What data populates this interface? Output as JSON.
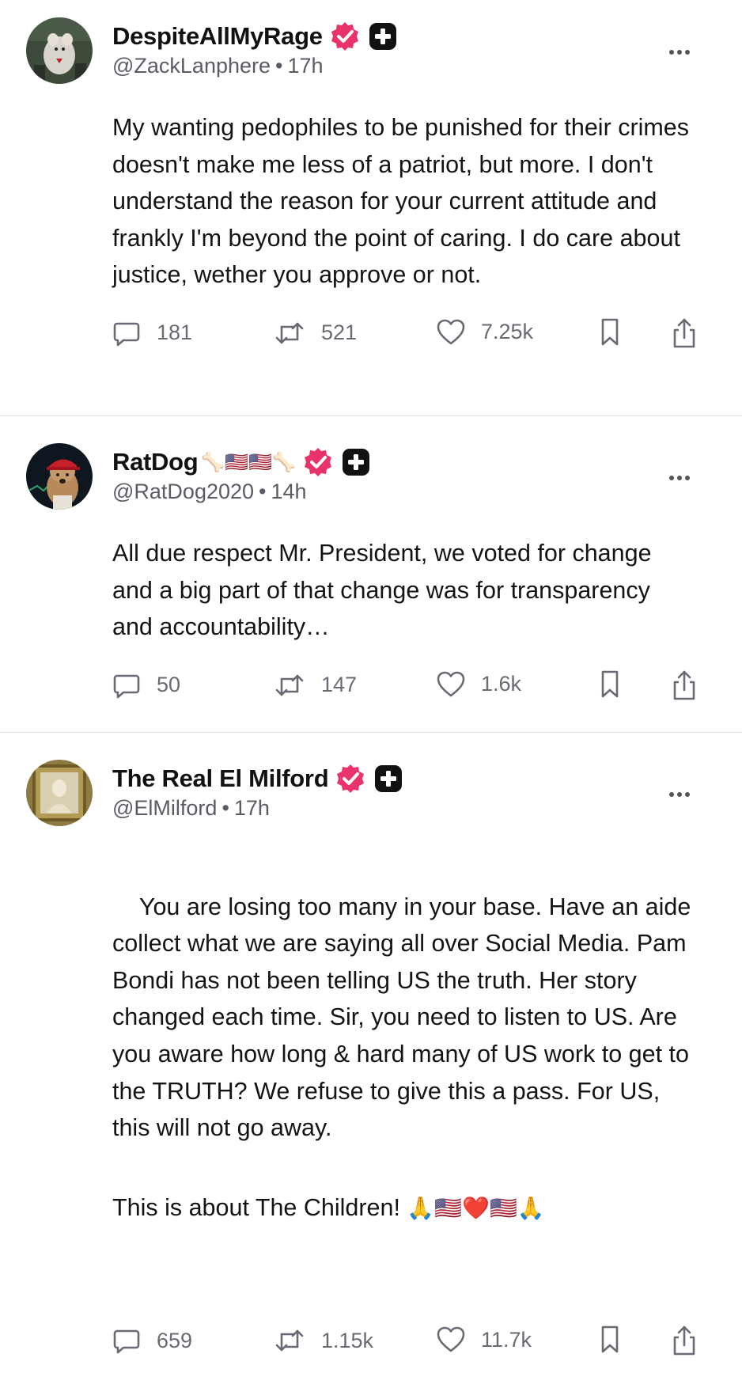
{
  "posts": [
    {
      "display_name": "DespiteAllMyRage",
      "name_emojis": "",
      "handle": "@ZackLanphere",
      "time": "17h",
      "body": "My wanting pedophiles to be punished for their crimes doesn't make me less of a patriot, but more. I don't understand the reason for your current attitude and frankly I'm beyond the point of caring. I do care about justice, wether you approve or not.",
      "body_emojis": "",
      "replies": "181",
      "reposts": "521",
      "likes": "7.25k",
      "avatar_icon": "rat-avatar"
    },
    {
      "display_name": "RatDog",
      "name_emojis": "🦴🇺🇸🇺🇸🦴",
      "handle": "@RatDog2020",
      "time": "14h",
      "body": "All due respect Mr. President, we voted for change and a big part of that change was for transparency and accountability…",
      "body_emojis": "",
      "replies": "50",
      "reposts": "147",
      "likes": "1.6k",
      "avatar_icon": "dog-avatar"
    },
    {
      "display_name": "The Real El Milford",
      "name_emojis": "",
      "handle": "@ElMilford",
      "time": "17h",
      "body": "You are losing too many in your base. Have an aide collect what we are saying all over Social Media. Pam Bondi has not been telling US the truth. Her story changed each time. Sir, you need to listen to US. Are you aware how long & hard many of US work to get to the TRUTH? We refuse to give this a pass. For US, this will not go away.",
      "body_tail": "This is about The Children! ",
      "body_emojis": "🙏🇺🇸❤️🇺🇸🙏",
      "replies": "659",
      "reposts": "1.15k",
      "likes": "11.7k",
      "avatar_icon": "portrait-avatar"
    }
  ],
  "colors": {
    "verified": "#e8336b",
    "icon_gray": "#6a6a74",
    "divider": "#e3e3e6",
    "text": "#141416"
  }
}
